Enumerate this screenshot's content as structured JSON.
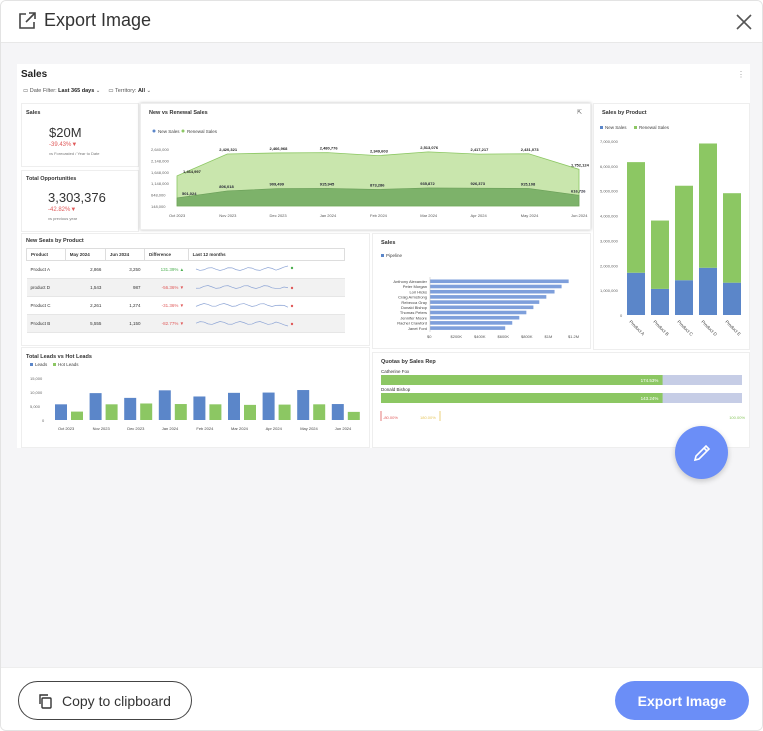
{
  "dialog": {
    "title": "Export Image",
    "copy_label": "Copy to clipboard",
    "export_label": "Export Image"
  },
  "dashboard": {
    "title": "Sales",
    "filters": [
      {
        "label": "Date Filter:",
        "value": "Last 365 days"
      },
      {
        "label": "Territory:",
        "value": "All"
      }
    ],
    "sales_kpi": {
      "title": "Sales",
      "value": "$20M",
      "delta": "-39.43%▼",
      "sub": "vs Forecasted / Year to Date"
    },
    "opps_kpi": {
      "title": "Total Opportunities",
      "value": "3,303,376",
      "delta": "-42.82%▼",
      "sub": "vs previous year"
    },
    "renewal": {
      "title": "New vs Renewal Sales",
      "legend": [
        "New Sales",
        "Renewal Sales"
      ],
      "y_ticks": [
        "2,640,000",
        "2,148,000",
        "1,648,000",
        "1,148,000",
        "648,000",
        "148,000"
      ],
      "months": [
        "Oct 2023",
        "Nov 2023",
        "Dec 2023",
        "Jan 2024",
        "Feb 2024",
        "Mar 2024",
        "Apr 2024",
        "May 2024",
        "Jun 2024"
      ],
      "renewal_values": [
        1464997,
        2420321,
        2466968,
        2480776,
        2349603,
        2513076,
        2417217,
        2431073,
        1752124
      ],
      "renewal_labels": [
        "1,464,997",
        "2,420,321",
        "2,466,968",
        "2,480,776",
        "2,349,603",
        "2,513,076",
        "2,417,217",
        "2,431,073",
        "1,752,124"
      ],
      "new_values": [
        501024,
        806018,
        909499,
        915945,
        873286,
        935872,
        926373,
        915108,
        616726
      ],
      "new_labels": [
        "501,024",
        "806,018",
        "909,499",
        "915,945",
        "873,286",
        "935,872",
        "926,373",
        "915,108",
        "616,726"
      ]
    },
    "by_product": {
      "title": "Sales by Product",
      "legend": [
        "New Sales",
        "Renewal Sales"
      ],
      "y_ticks": [
        "7,000,000",
        "6,000,000",
        "5,000,000",
        "4,000,000",
        "3,000,000",
        "2,000,000",
        "1,000,000",
        "0"
      ],
      "categories": [
        "Product A",
        "Product B",
        "Product C",
        "Product D",
        "Product E"
      ],
      "new_sales": [
        1700000,
        1050000,
        1400000,
        1900000,
        1300000
      ],
      "renewal_sales": [
        4450000,
        2750000,
        3800000,
        5000000,
        3600000
      ]
    },
    "seats": {
      "title": "New Seats by Product",
      "headers": [
        "Product",
        "May 2024",
        "Jun 2024",
        "Difference",
        "Last 12 months"
      ],
      "rows": [
        {
          "product": "Product A",
          "may": "2,866",
          "jun": "3,250",
          "diff": "131.39%",
          "trend": "up"
        },
        {
          "product": "product D",
          "may": "1,543",
          "jun": "987",
          "diff": "-56.36%",
          "trend": "down"
        },
        {
          "product": "Product C",
          "may": "2,261",
          "jun": "1,274",
          "diff": "-31.36%",
          "trend": "down"
        },
        {
          "product": "Product B",
          "may": "5,555",
          "jun": "1,150",
          "diff": "-82.77%",
          "trend": "down"
        }
      ]
    },
    "reps": {
      "title": "Sales",
      "legend": "Pipeline",
      "names": [
        "Anthony Alexander",
        "Peter Morgan",
        "Lori Hicks",
        "Craig Armstrong",
        "Rebecca Gray",
        "Donald Bishop",
        "Thomas Peters",
        "Jennifer Moore",
        "Rachel Crawford",
        "Janet Ford"
      ],
      "values": [
        1180000,
        1120000,
        1060000,
        990000,
        930000,
        880000,
        820000,
        760000,
        700000,
        640000
      ],
      "x_ticks": [
        "$0",
        "$200K",
        "$400K",
        "$600K",
        "$800K",
        "$1M",
        "$1.2M"
      ]
    },
    "leads": {
      "title": "Total Leads vs Hot Leads",
      "legend": [
        "Leads",
        "Hot Leads"
      ],
      "y_ticks": [
        "15,000",
        "10,000",
        "5,000",
        "0"
      ],
      "months": [
        "Oct 2023",
        "Nov 2023",
        "Dec 2023",
        "Jan 2024",
        "Feb 2024",
        "Mar 2024",
        "Apr 2024",
        "May 2024",
        "Jun 2024"
      ],
      "leads": [
        5600,
        9600,
        7900,
        10600,
        8400,
        9700,
        9800,
        10700,
        5700
      ],
      "hot_leads": [
        3000,
        5600,
        5900,
        5700,
        5600,
        5400,
        5500,
        5600,
        2900
      ]
    },
    "quota": {
      "title": "Quotas by Sales Rep",
      "reps": [
        {
          "name": "Catherine Fox",
          "pct": "174.53%",
          "fill": 0.78
        },
        {
          "name": "Donald Bishop",
          "pct": "143.24%",
          "fill": 0.78
        }
      ],
      "scale": [
        "-80.00%",
        "180.00%",
        "100.00%"
      ]
    }
  },
  "colors": {
    "blue": "#5b86c9",
    "green": "#8cc763",
    "accent": "#6b8ef7"
  }
}
